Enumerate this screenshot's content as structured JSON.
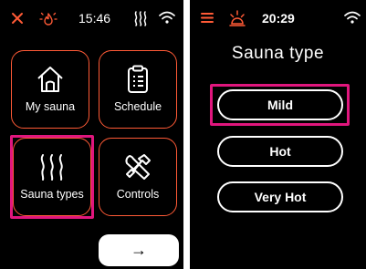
{
  "left_screen": {
    "status": {
      "time": "15:46"
    },
    "tiles": [
      {
        "label": "My sauna",
        "icon": "home-icon"
      },
      {
        "label": "Schedule",
        "icon": "clipboard-icon"
      },
      {
        "label": "Sauna types",
        "icon": "steam-icon"
      },
      {
        "label": "Controls",
        "icon": "tools-icon"
      }
    ],
    "next_button": {
      "label": "→"
    }
  },
  "right_screen": {
    "status": {
      "time": "20:29"
    },
    "title": "Sauna type",
    "options": [
      {
        "label": "Mild"
      },
      {
        "label": "Hot"
      },
      {
        "label": "Very Hot"
      }
    ]
  },
  "colors": {
    "accent": "#ff5a36",
    "highlight": "#e0167d",
    "background": "#000000",
    "text": "#ffffff"
  }
}
